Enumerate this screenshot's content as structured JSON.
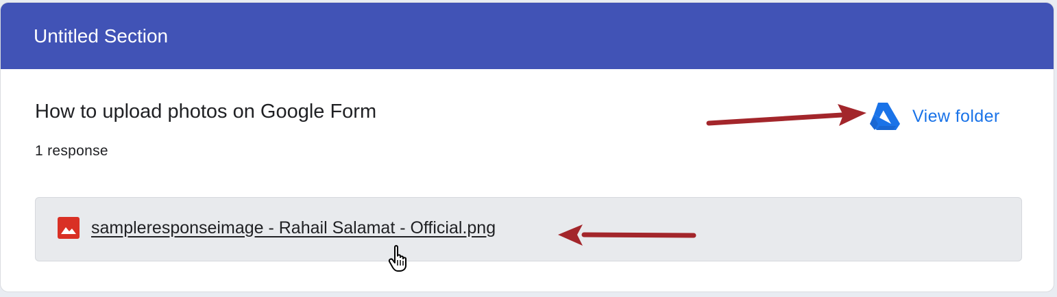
{
  "section": {
    "title": "Untitled Section"
  },
  "question": {
    "title": "How to upload photos on Google Form",
    "response_count": "1 response"
  },
  "folder_link": {
    "label": "View folder",
    "icon": "google-drive-icon"
  },
  "file": {
    "name": "sampleresponseimage - Rahail Salamat - Official.png",
    "icon": "image-file-icon"
  },
  "colors": {
    "header_bg": "#4153b6",
    "link": "#1a73e8",
    "file_icon": "#d93025",
    "annotation_arrow": "#a3262b",
    "file_box_bg": "#e8eaed"
  }
}
